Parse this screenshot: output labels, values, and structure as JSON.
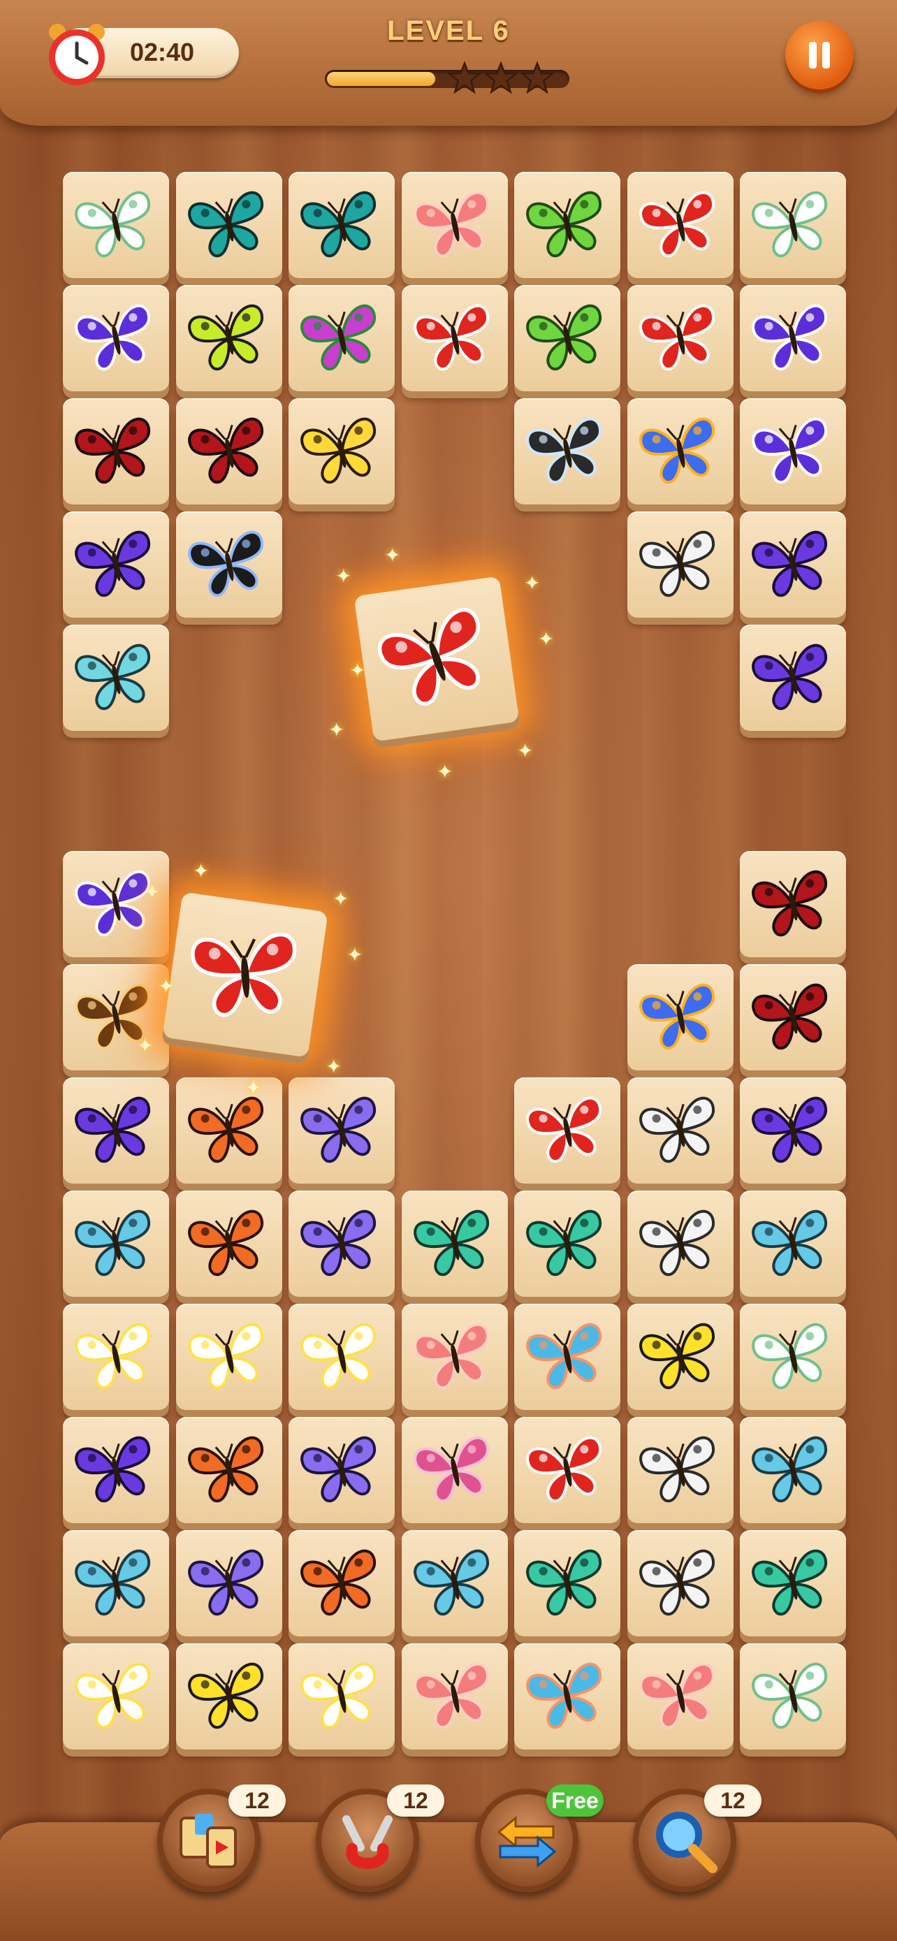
{
  "hud": {
    "timer": "02:40",
    "level": "LEVEL 6",
    "progress": 0.45,
    "stars_earned": 0,
    "stars_total": 3,
    "pause_icon": "pause-icon"
  },
  "tools": [
    {
      "name": "shuffle-tool",
      "icon": "swap-cards-icon",
      "count": "12"
    },
    {
      "name": "magnet-tool",
      "icon": "magnet-icon",
      "count": "12"
    },
    {
      "name": "undo-tool",
      "icon": "swap-arrows-icon",
      "count": "Free"
    },
    {
      "name": "hint-tool",
      "icon": "magnifier-icon",
      "count": "12"
    }
  ],
  "colors": {
    "accent": "#e05d10",
    "free_badge": "#4ec43a",
    "tile_face": "#f3d8ae"
  },
  "butterflies": {
    "whitegreen": [
      "#ffffff",
      "#6fc08a"
    ],
    "teal": [
      "#1ea7a0",
      "#0d2e2e"
    ],
    "salmon": [
      "#f57c7c",
      "#ffd0c4"
    ],
    "green": [
      "#6fd640",
      "#1f4d12"
    ],
    "red": [
      "#e0241e",
      "#ffffff"
    ],
    "purple": [
      "#5b2ed9",
      "#ffffff"
    ],
    "lime": [
      "#c8ec2a",
      "#1d1d1d"
    ],
    "magenta": [
      "#c83fcf",
      "#2a8a3a"
    ],
    "darkred": [
      "#b2161a",
      "#1a0a0a"
    ],
    "yellow": [
      "#ffd93a",
      "#2a1a00"
    ],
    "black": [
      "#2a2a2a",
      "#cfe6ff"
    ],
    "blue": [
      "#3d6cf0",
      "#ffb020"
    ],
    "whiteblack": [
      "#f4f4f4",
      "#2a2a2a"
    ],
    "violet": [
      "#6a3ae0",
      "#1a0a3a"
    ],
    "darkblue": [
      "#1b1b1b",
      "#8fb8ff"
    ],
    "cyan": [
      "#72d7e0",
      "#1a3a40"
    ],
    "brown": [
      "#6b3a12",
      "#f5d58a"
    ],
    "orange": [
      "#f26b24",
      "#2a0e00"
    ],
    "lavender": [
      "#8a6cf0",
      "#1e1440"
    ],
    "mint": [
      "#38c9a2",
      "#0e3a2e"
    ],
    "whiteyellow": [
      "#ffffff",
      "#ffe14a"
    ],
    "pink": [
      "#e0528f",
      "#f5c0d6"
    ],
    "bluesalmon": [
      "#4bb9e6",
      "#f5946a"
    ],
    "yellowblack": [
      "#ffe02a",
      "#1a1a1a"
    ],
    "sky": [
      "#66c9e6",
      "#1a3a44"
    ]
  },
  "tiles": [
    {
      "r": 0,
      "c": 0,
      "b": "whitegreen"
    },
    {
      "r": 0,
      "c": 1,
      "b": "teal"
    },
    {
      "r": 0,
      "c": 2,
      "b": "teal"
    },
    {
      "r": 0,
      "c": 3,
      "b": "salmon"
    },
    {
      "r": 0,
      "c": 4,
      "b": "green"
    },
    {
      "r": 0,
      "c": 5,
      "b": "red"
    },
    {
      "r": 0,
      "c": 6,
      "b": "whitegreen"
    },
    {
      "r": 1,
      "c": 0,
      "b": "purple"
    },
    {
      "r": 1,
      "c": 1,
      "b": "lime"
    },
    {
      "r": 1,
      "c": 2,
      "b": "magenta"
    },
    {
      "r": 1,
      "c": 3,
      "b": "red"
    },
    {
      "r": 1,
      "c": 4,
      "b": "green"
    },
    {
      "r": 1,
      "c": 5,
      "b": "red"
    },
    {
      "r": 1,
      "c": 6,
      "b": "purple"
    },
    {
      "r": 2,
      "c": 0,
      "b": "darkred"
    },
    {
      "r": 2,
      "c": 1,
      "b": "darkred"
    },
    {
      "r": 2,
      "c": 2,
      "b": "yellow"
    },
    {
      "r": 2,
      "c": 4,
      "b": "black"
    },
    {
      "r": 2,
      "c": 5,
      "b": "blue"
    },
    {
      "r": 2,
      "c": 6,
      "b": "purple"
    },
    {
      "r": 3,
      "c": 0,
      "b": "violet"
    },
    {
      "r": 3,
      "c": 1,
      "b": "darkblue"
    },
    {
      "r": 3,
      "c": 5,
      "b": "whiteblack"
    },
    {
      "r": 3,
      "c": 6,
      "b": "violet"
    },
    {
      "r": 4,
      "c": 0,
      "b": "cyan"
    },
    {
      "r": 4,
      "c": 6,
      "b": "violet"
    },
    {
      "r": 6,
      "c": 0,
      "b": "purple"
    },
    {
      "r": 6,
      "c": 6,
      "b": "darkred"
    },
    {
      "r": 7,
      "c": 0,
      "b": "brown"
    },
    {
      "r": 7,
      "c": 5,
      "b": "blue"
    },
    {
      "r": 7,
      "c": 6,
      "b": "darkred"
    },
    {
      "r": 8,
      "c": 0,
      "b": "violet"
    },
    {
      "r": 8,
      "c": 1,
      "b": "orange"
    },
    {
      "r": 8,
      "c": 2,
      "b": "lavender"
    },
    {
      "r": 8,
      "c": 4,
      "b": "red"
    },
    {
      "r": 8,
      "c": 5,
      "b": "whiteblack"
    },
    {
      "r": 8,
      "c": 6,
      "b": "violet"
    },
    {
      "r": 9,
      "c": 0,
      "b": "sky"
    },
    {
      "r": 9,
      "c": 1,
      "b": "orange"
    },
    {
      "r": 9,
      "c": 2,
      "b": "lavender"
    },
    {
      "r": 9,
      "c": 3,
      "b": "mint"
    },
    {
      "r": 9,
      "c": 4,
      "b": "mint"
    },
    {
      "r": 9,
      "c": 5,
      "b": "whiteblack"
    },
    {
      "r": 9,
      "c": 6,
      "b": "sky"
    },
    {
      "r": 10,
      "c": 0,
      "b": "whiteyellow"
    },
    {
      "r": 10,
      "c": 1,
      "b": "whiteyellow"
    },
    {
      "r": 10,
      "c": 2,
      "b": "whiteyellow"
    },
    {
      "r": 10,
      "c": 3,
      "b": "salmon"
    },
    {
      "r": 10,
      "c": 4,
      "b": "bluesalmon"
    },
    {
      "r": 10,
      "c": 5,
      "b": "yellowblack"
    },
    {
      "r": 10,
      "c": 6,
      "b": "whitegreen"
    },
    {
      "r": 11,
      "c": 0,
      "b": "violet"
    },
    {
      "r": 11,
      "c": 1,
      "b": "orange"
    },
    {
      "r": 11,
      "c": 2,
      "b": "lavender"
    },
    {
      "r": 11,
      "c": 3,
      "b": "pink"
    },
    {
      "r": 11,
      "c": 4,
      "b": "red"
    },
    {
      "r": 11,
      "c": 5,
      "b": "whiteblack"
    },
    {
      "r": 11,
      "c": 6,
      "b": "sky"
    },
    {
      "r": 12,
      "c": 0,
      "b": "sky"
    },
    {
      "r": 12,
      "c": 1,
      "b": "lavender"
    },
    {
      "r": 12,
      "c": 2,
      "b": "orange"
    },
    {
      "r": 12,
      "c": 3,
      "b": "sky"
    },
    {
      "r": 12,
      "c": 4,
      "b": "mint"
    },
    {
      "r": 12,
      "c": 5,
      "b": "whiteblack"
    },
    {
      "r": 12,
      "c": 6,
      "b": "mint"
    },
    {
      "r": 13,
      "c": 0,
      "b": "whiteyellow"
    },
    {
      "r": 13,
      "c": 1,
      "b": "yellowblack"
    },
    {
      "r": 13,
      "c": 2,
      "b": "whiteyellow"
    },
    {
      "r": 13,
      "c": 3,
      "b": "salmon"
    },
    {
      "r": 13,
      "c": 4,
      "b": "bluesalmon"
    },
    {
      "r": 13,
      "c": 5,
      "b": "salmon"
    },
    {
      "r": 13,
      "c": 6,
      "b": "whitegreen"
    }
  ],
  "selected_tiles": [
    {
      "b": "red",
      "state": "selected"
    },
    {
      "b": "red",
      "state": "selected"
    }
  ]
}
